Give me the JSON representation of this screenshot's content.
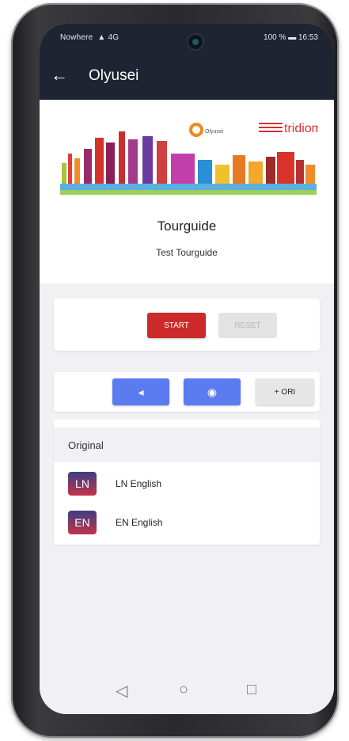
{
  "status_bar": {
    "carrier": "Nowhere",
    "signal_text": "4G",
    "battery": "100 %",
    "time": "16:53"
  },
  "appbar": {
    "back_icon": "arrow-left-icon",
    "title": "Olyusei"
  },
  "hero": {
    "logo_olyusei": "Olyusei",
    "logo_tridiom": "tridiom",
    "tourguide_title": "Tourguide",
    "tourguide_subtitle": "Test Tourguide"
  },
  "controls": {
    "start_label": "START",
    "reset_label": "RESET",
    "volume_down_icon": "volume-down-icon",
    "volume_up_icon": "volume-up-icon",
    "volume_down_glyph": "◂",
    "volume_up_glyph": "◉",
    "ori_label": "+ ORI"
  },
  "languages": {
    "header": "Original",
    "items": [
      {
        "code": "LN",
        "label": "LN English"
      },
      {
        "code": "EN",
        "label": "EN English"
      }
    ]
  },
  "navbar": {
    "back_glyph": "◁",
    "home_glyph": "○",
    "recent_glyph": "□"
  },
  "colors": {
    "appbar": "#1f2433",
    "start": "#cc2a2a",
    "volume": "#5b7bf0",
    "badge_top": "#3b3e86",
    "badge_bottom": "#c4334a"
  }
}
